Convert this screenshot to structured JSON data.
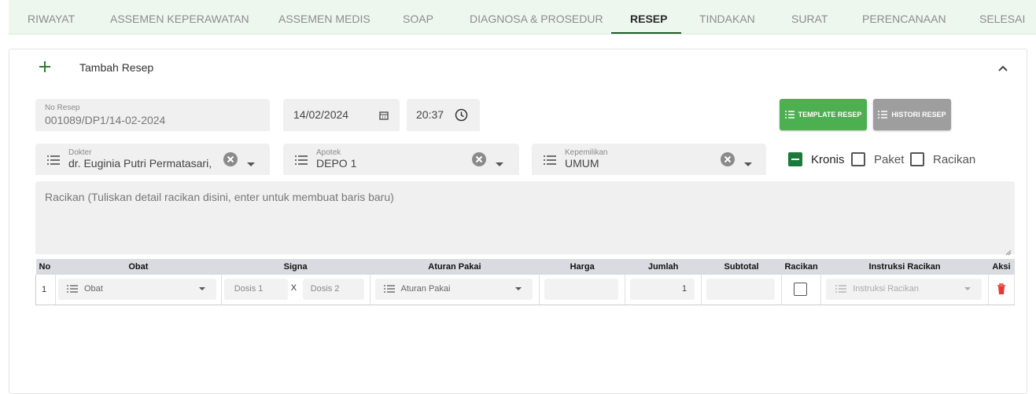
{
  "tabs": [
    {
      "label": "RIWAYAT"
    },
    {
      "label": "ASSEMEN KEPERAWATAN"
    },
    {
      "label": "ASSEMEN MEDIS"
    },
    {
      "label": "SOAP"
    },
    {
      "label": "DIAGNOSA & PROSEDUR"
    },
    {
      "label": "RESEP"
    },
    {
      "label": "TINDAKAN"
    },
    {
      "label": "SURAT"
    },
    {
      "label": "PERENCANAAN"
    },
    {
      "label": "SELESAI"
    }
  ],
  "active_tab": "RESEP",
  "panel": {
    "title": "Tambah Resep"
  },
  "form": {
    "no_resep_label": "No Resep",
    "no_resep_value": "001089/DP1/14-02-2024",
    "date_value": "14/02/2024",
    "time_value": "20:37",
    "template_button": "TEMPLATE RESEP",
    "histori_button": "HISTORI RESEP",
    "dokter_label": "Dokter",
    "dokter_value": "dr. Euginia Putri Permatasari,",
    "apotek_label": "Apotek",
    "apotek_value": "DEPO 1",
    "kepemilikan_label": "Kepemilikan",
    "kepemilikan_value": "UMUM",
    "kronis_label": "Kronis",
    "paket_label": "Paket",
    "racikan_label": "Racikan",
    "kronis_state": "indeterminate",
    "racikan_textarea_placeholder": "Racikan (Tuliskan detail racikan disini, enter untuk membuat baris baru)"
  },
  "table": {
    "headers": [
      "No",
      "Obat",
      "Signa",
      "Aturan Pakai",
      "Harga",
      "Jumlah",
      "Subtotal",
      "Racikan",
      "Instruksi Racikan",
      "Aksi"
    ],
    "rows": [
      {
        "no": "1",
        "obat_placeholder": "Obat",
        "dosis1_placeholder": "Dosis 1",
        "x": "X",
        "dosis2_placeholder": "Dosis 2",
        "aturan_placeholder": "Aturan Pakai",
        "harga": "",
        "jumlah": "1",
        "subtotal": "",
        "instruksi_placeholder": "Instruksi Racikan"
      }
    ]
  },
  "colors": {
    "accent_green": "#4caf50",
    "dark_green": "#1e5a2a",
    "grey_button": "#9e9e9e",
    "delete_red": "#e53935"
  }
}
